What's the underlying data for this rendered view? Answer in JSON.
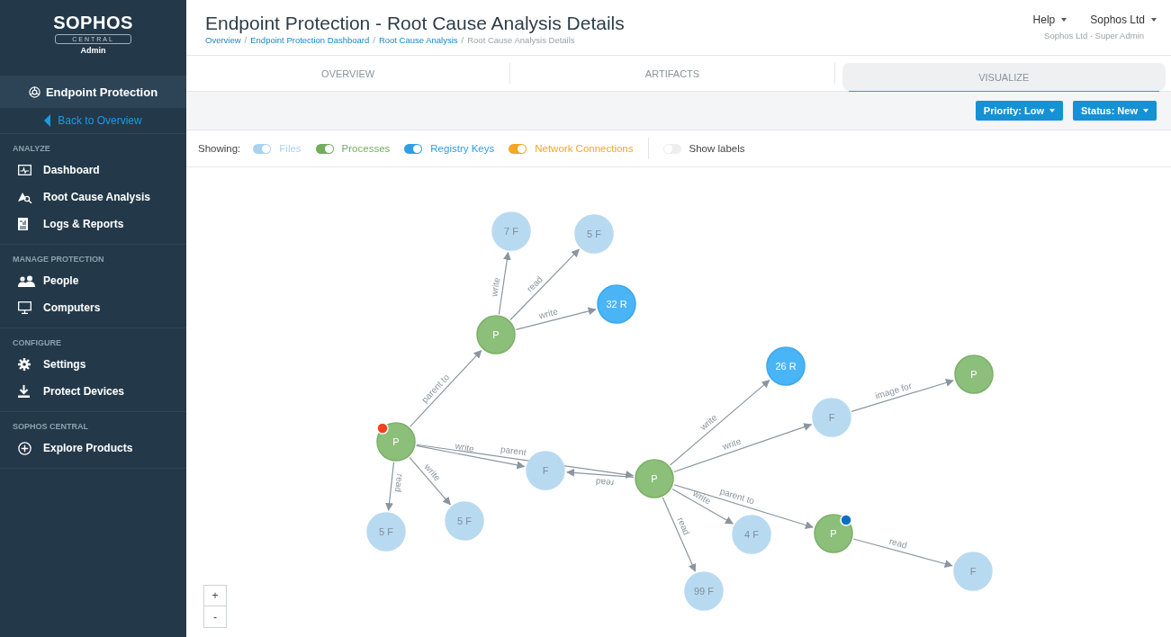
{
  "sidebar": {
    "logo": {
      "brand": "SOPHOS",
      "product": "CENTRAL",
      "role": "Admin"
    },
    "section": "Endpoint Protection",
    "back_link": "Back to Overview",
    "groups": [
      {
        "heading": "ANALYZE",
        "items": [
          {
            "label": "Dashboard"
          },
          {
            "label": "Root Cause Analysis"
          },
          {
            "label": "Logs & Reports"
          }
        ]
      },
      {
        "heading": "MANAGE PROTECTION",
        "items": [
          {
            "label": "People"
          },
          {
            "label": "Computers"
          }
        ]
      },
      {
        "heading": "CONFIGURE",
        "items": [
          {
            "label": "Settings"
          },
          {
            "label": "Protect Devices"
          }
        ]
      },
      {
        "heading": "SOPHOS CENTRAL",
        "items": [
          {
            "label": "Explore Products"
          }
        ]
      }
    ]
  },
  "header": {
    "title": "Endpoint Protection - Root Cause Analysis Details",
    "breadcrumbs": [
      {
        "label": "Overview",
        "link": true
      },
      {
        "label": "Endpoint Protection Dashboard",
        "link": true
      },
      {
        "label": "Root Cause Analysis",
        "link": true
      },
      {
        "label": "Root Cause Analysis Details",
        "link": false
      }
    ],
    "separators": [
      "/",
      "/",
      "/"
    ],
    "menus": [
      "Help",
      "Sophos Ltd"
    ],
    "account": "Sophos Ltd · Super Admin"
  },
  "tabs": [
    {
      "label": "OVERVIEW",
      "selected": false
    },
    {
      "label": "ARTIFACTS",
      "selected": false
    },
    {
      "label": "VISUALIZE",
      "selected": true
    }
  ],
  "actions": [
    "Priority: Low",
    "Status: New"
  ],
  "filters": {
    "label": "Showing:",
    "items": [
      {
        "label": "Files",
        "on": true,
        "color": "#a9d3ef"
      },
      {
        "label": "Processes",
        "on": true,
        "color": "#6fae5c"
      },
      {
        "label": "Registry Keys",
        "on": true,
        "color": "#2d9fe6"
      },
      {
        "label": "Network Connections",
        "on": true,
        "color": "#f5a623"
      }
    ],
    "show_labels": {
      "label": "Show labels",
      "on": false
    }
  },
  "graph": {
    "nodes": [
      {
        "label": "P",
        "kind": "process",
        "badge": {
          "color": "#f2401d"
        }
      },
      {
        "label": "P",
        "kind": "process"
      },
      {
        "label": "7 F",
        "kind": "file"
      },
      {
        "label": "5 F",
        "kind": "file"
      },
      {
        "label": "32 R",
        "kind": "registry"
      },
      {
        "label": "F",
        "kind": "file"
      },
      {
        "label": "P",
        "kind": "process"
      },
      {
        "label": "5 F",
        "kind": "file"
      },
      {
        "label": "5 F",
        "kind": "file"
      },
      {
        "label": "26 R",
        "kind": "registry"
      },
      {
        "label": "F",
        "kind": "file"
      },
      {
        "label": "P",
        "kind": "process"
      },
      {
        "label": "4 F",
        "kind": "file"
      },
      {
        "label": "P",
        "kind": "process",
        "badge": {
          "color": "#0a6fc2"
        }
      },
      {
        "label": "F",
        "kind": "file"
      },
      {
        "label": "99 F",
        "kind": "file"
      }
    ],
    "edges": [
      {
        "label": "parent to"
      },
      {
        "label": "write"
      },
      {
        "label": "read"
      },
      {
        "label": "write"
      },
      {
        "label": "write"
      },
      {
        "label": "parent"
      },
      {
        "label": "read"
      },
      {
        "label": "read"
      },
      {
        "label": "write"
      },
      {
        "label": "write"
      },
      {
        "label": "write"
      },
      {
        "label": "image for"
      },
      {
        "label": "write"
      },
      {
        "label": "parent to"
      },
      {
        "label": "read"
      },
      {
        "label": "read"
      }
    ]
  },
  "zoom_controls": [
    "+",
    "-"
  ]
}
